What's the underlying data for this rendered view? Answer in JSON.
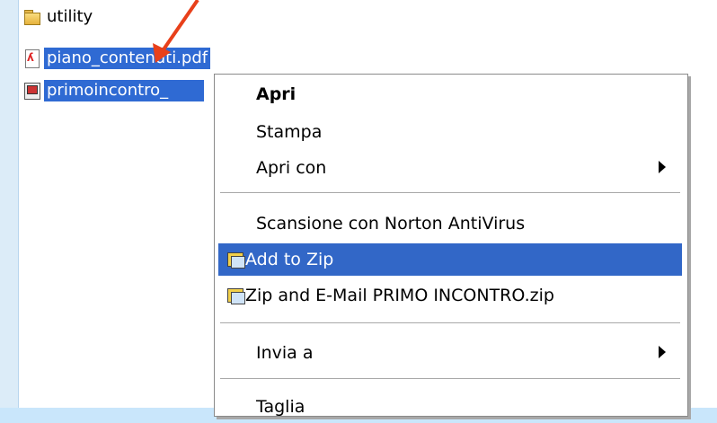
{
  "explorer": {
    "files": [
      {
        "name": "utility",
        "icon": "folder-icon",
        "selected": false
      },
      {
        "name": "piano_contenuti.pdf",
        "icon": "pdf-icon",
        "selected": true
      },
      {
        "name": "primoincontro_",
        "icon": "presentation-icon",
        "selected": true
      }
    ]
  },
  "context_menu": {
    "items": [
      {
        "label": "Apri",
        "bold": true
      },
      {
        "label": "Stampa"
      },
      {
        "label": "Apri con",
        "submenu": true
      },
      {
        "label": "Scansione con Norton AntiVirus"
      },
      {
        "label": "Add to Zip",
        "highlighted": true,
        "icon": "zip-icon"
      },
      {
        "label": "Zip and E-Mail PRIMO INCONTRO.zip",
        "icon": "zip-mail-icon"
      },
      {
        "label": "Invia a",
        "submenu": true
      },
      {
        "label": "Taglia"
      }
    ]
  },
  "colors": {
    "selection": "#2f6ad3",
    "menu_highlight": "#3267c7",
    "annotation_arrow": "#e8401a",
    "background": "#c9e6fb"
  }
}
